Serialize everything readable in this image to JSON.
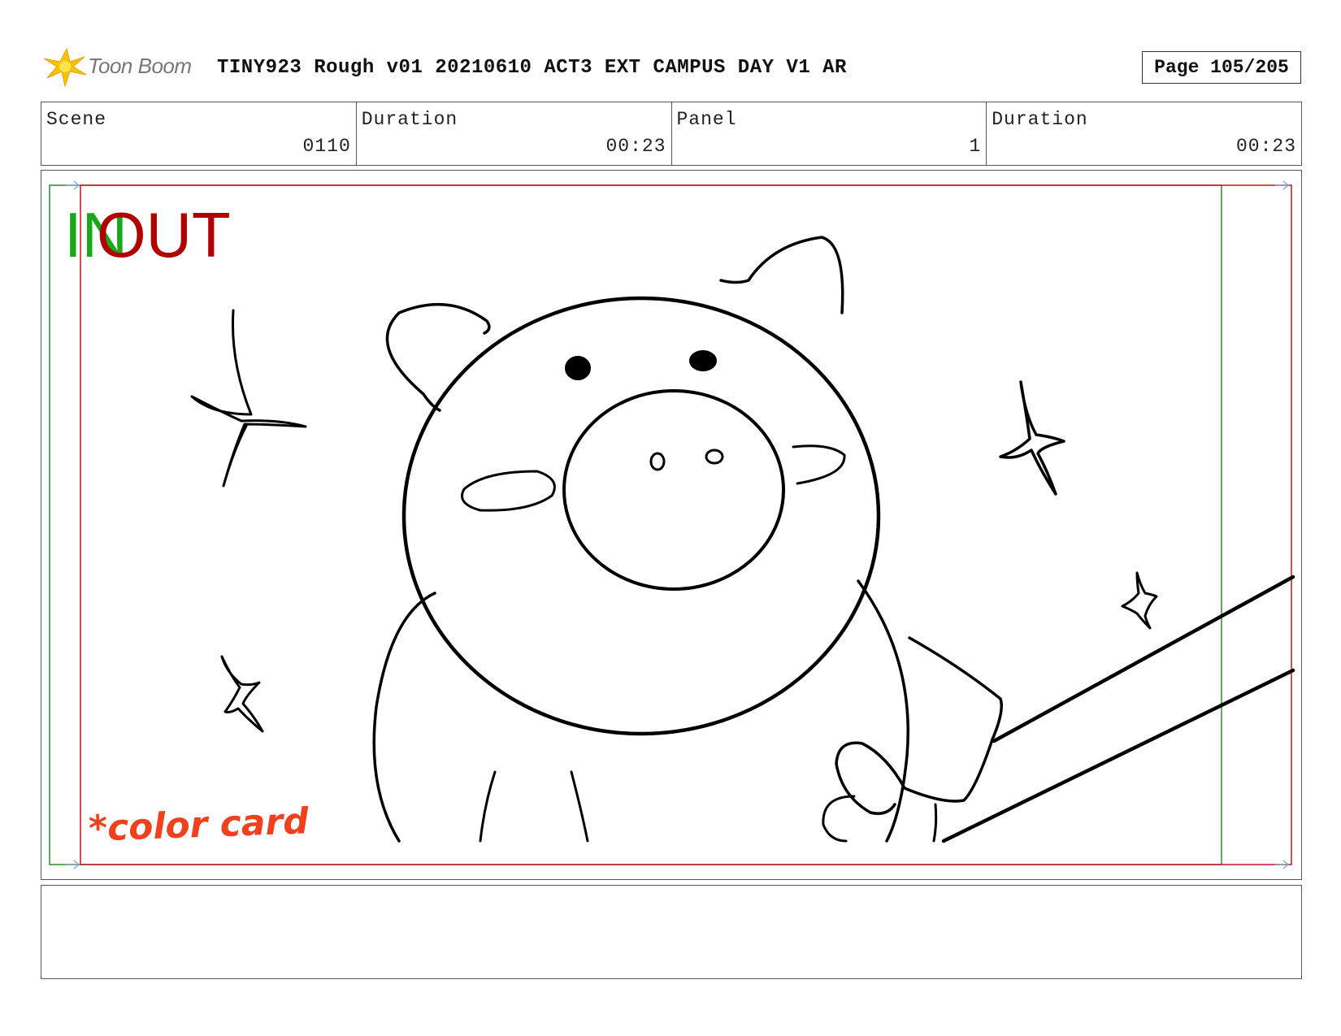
{
  "header": {
    "logo_text": "Toon Boom",
    "title": "TINY923 Rough v01 20210610 ACT3 EXT CAMPUS DAY V1 AR",
    "page": "Page 105/205"
  },
  "info": {
    "scene_label": "Scene",
    "scene_value": "0110",
    "duration_label": "Duration",
    "duration_value": "00:23",
    "panel_label": "Panel",
    "panel_value": "1",
    "panel_duration_label": "Duration",
    "panel_duration_value": "00:23"
  },
  "panel": {
    "in_label": "IN",
    "out_label": "OUT",
    "note": "*color card",
    "in_frame_color": "#2e8b2e",
    "out_frame_color": "#c0161e"
  },
  "caption": {
    "text": ""
  },
  "colors": {
    "in": "#1aa81a",
    "out": "#b00000",
    "note": "#f0401e",
    "logo_star": "#f5c400"
  }
}
